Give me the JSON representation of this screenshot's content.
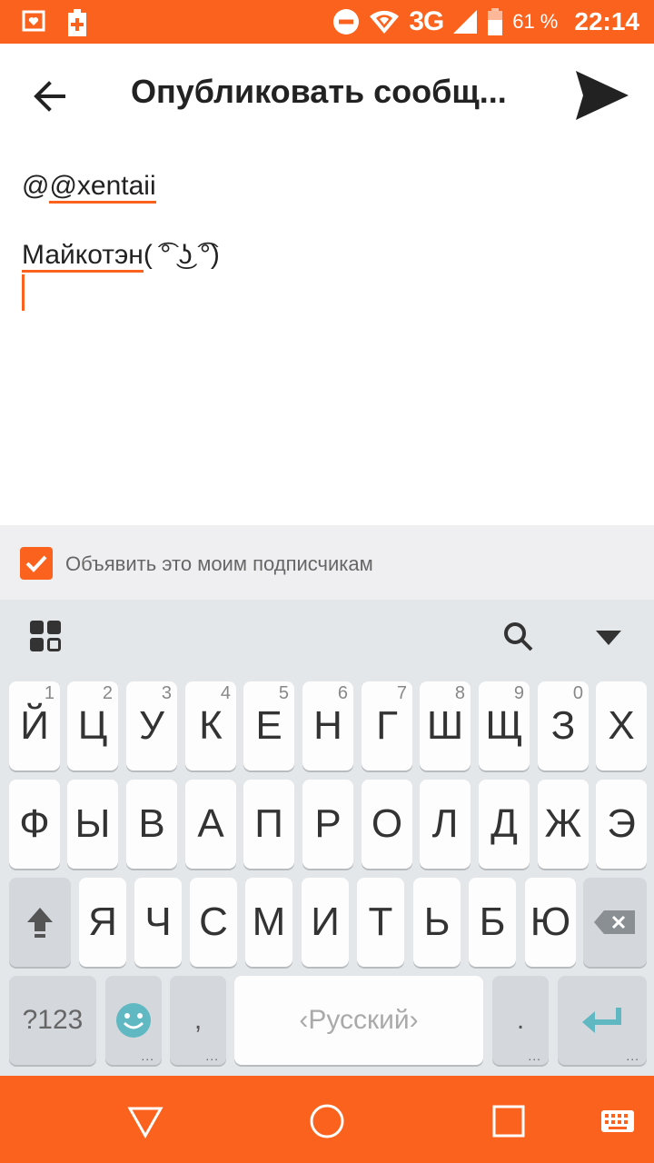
{
  "status_bar": {
    "network": "3G",
    "battery_percent": "61 %",
    "time": "22:14",
    "icons": [
      "notification-icon",
      "battery-saver-icon",
      "dnd-icon",
      "wifi-icon",
      "signal-icon",
      "battery-icon"
    ]
  },
  "app_bar": {
    "title": "Опубликовать сообщ...",
    "back_icon": "arrow-left-icon",
    "send_icon": "send-icon"
  },
  "compose": {
    "mention": "@xentaii",
    "text_word": "Майкотэн",
    "text_face": "( ͡° ͜ʖ ͡°)"
  },
  "announce": {
    "checked": true,
    "label": "Объявить это моим подписчикам"
  },
  "keyboard": {
    "row1": [
      {
        "k": "Й",
        "h": "1"
      },
      {
        "k": "Ц",
        "h": "2"
      },
      {
        "k": "У",
        "h": "3"
      },
      {
        "k": "К",
        "h": "4"
      },
      {
        "k": "Е",
        "h": "5"
      },
      {
        "k": "Н",
        "h": "6"
      },
      {
        "k": "Г",
        "h": "7"
      },
      {
        "k": "Ш",
        "h": "8"
      },
      {
        "k": "Щ",
        "h": "9"
      },
      {
        "k": "З",
        "h": "0"
      },
      {
        "k": "Х",
        "h": ""
      }
    ],
    "row2": [
      "Ф",
      "Ы",
      "В",
      "А",
      "П",
      "Р",
      "О",
      "Л",
      "Д",
      "Ж",
      "Э"
    ],
    "row3": [
      "Я",
      "Ч",
      "С",
      "М",
      "И",
      "Т",
      "Ь",
      "Б",
      "Ю"
    ],
    "numbers_label": "?123",
    "comma": ",",
    "space_label": "Русский",
    "period": ".",
    "accent_color": "#fb621d",
    "key_accent_color": "#5fb8c2"
  },
  "navbar": {
    "icons": [
      "back-triangle-icon",
      "home-circle-icon",
      "recents-square-icon",
      "keyboard-icon"
    ]
  }
}
